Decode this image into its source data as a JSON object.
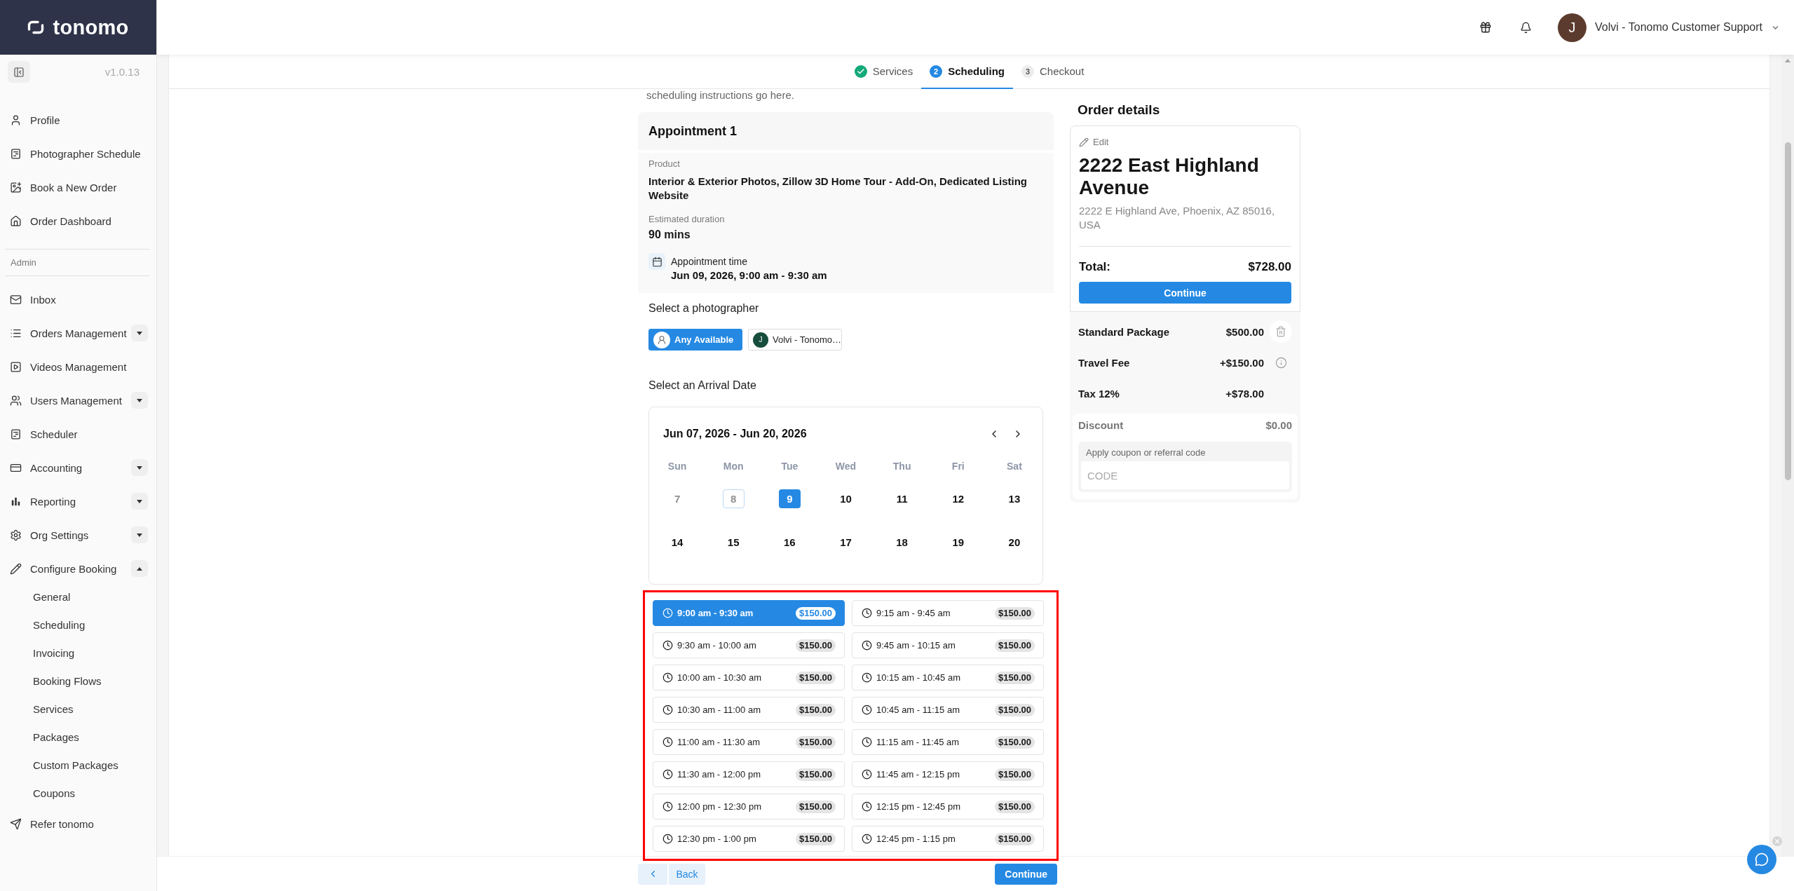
{
  "sidebar": {
    "logo": "tonomo",
    "version": "v1.0.13",
    "items": [
      {
        "label": "Profile"
      },
      {
        "label": "Photographer Schedule"
      },
      {
        "label": "Book a New Order"
      },
      {
        "label": "Order Dashboard"
      }
    ],
    "admin": {
      "heading": "Admin",
      "items": [
        {
          "kind": "link",
          "label": "Inbox"
        },
        {
          "kind": "group",
          "label": "Orders Management",
          "expanded": false
        },
        {
          "kind": "link",
          "label": "Videos Management"
        },
        {
          "kind": "group",
          "label": "Users Management",
          "expanded": false
        },
        {
          "kind": "link",
          "label": "Scheduler"
        },
        {
          "kind": "group",
          "label": "Accounting",
          "expanded": false
        },
        {
          "kind": "group",
          "label": "Reporting",
          "expanded": false
        },
        {
          "kind": "group",
          "label": "Org Settings",
          "expanded": false
        },
        {
          "kind": "group",
          "label": "Configure Booking",
          "expanded": true,
          "children": [
            {
              "label": "General"
            },
            {
              "label": "Scheduling"
            },
            {
              "label": "Invoicing"
            },
            {
              "label": "Booking Flows"
            },
            {
              "label": "Services"
            },
            {
              "label": "Packages"
            },
            {
              "label": "Custom Packages"
            },
            {
              "label": "Coupons"
            }
          ]
        },
        {
          "kind": "link",
          "label": "Refer tonomo"
        }
      ]
    }
  },
  "header": {
    "user_name": "Volvi - Tonomo Customer Support",
    "avatar_initial": "J"
  },
  "stepper": {
    "steps": [
      {
        "label": "Services",
        "done": true,
        "selected": false
      },
      {
        "number": "2",
        "label": "Scheduling",
        "done": false,
        "selected": true
      },
      {
        "number": "3",
        "label": "Checkout",
        "done": false,
        "selected": false
      }
    ]
  },
  "scheduling": {
    "instructions": "scheduling instructions go here.",
    "appointment": {
      "title": "Appointment 1",
      "product_label": "Product",
      "product": "Interior & Exterior Photos, Zillow 3D Home Tour - Add-On, Dedicated Listing Website",
      "duration_label": "Estimated duration",
      "duration": "90 mins",
      "time_label": "Appointment time",
      "time": "Jun 09, 2026, 9:00 am - 9:30 am"
    },
    "photographer": {
      "heading": "Select a photographer",
      "options": [
        {
          "kind": "any",
          "label": "Any Available",
          "selected": true
        },
        {
          "kind": "person",
          "initial": "J",
          "label": "Volvi - Tonomo…",
          "selected": false
        }
      ]
    },
    "calendar": {
      "heading": "Select an Arrival Date",
      "range": "Jun 07, 2026 - Jun 20, 2026",
      "weekdays": [
        "Sun",
        "Mon",
        "Tue",
        "Wed",
        "Thu",
        "Fri",
        "Sat"
      ],
      "weeks": [
        [
          {
            "day": "7",
            "disabled": true,
            "today": false,
            "selected": false
          },
          {
            "day": "8",
            "disabled": true,
            "today": true,
            "selected": false
          },
          {
            "day": "9",
            "disabled": false,
            "today": false,
            "selected": true
          },
          {
            "day": "10",
            "disabled": false,
            "today": false,
            "selected": false
          },
          {
            "day": "11",
            "disabled": false,
            "today": false,
            "selected": false
          },
          {
            "day": "12",
            "disabled": false,
            "today": false,
            "selected": false
          },
          {
            "day": "13",
            "disabled": false,
            "today": false,
            "selected": false
          }
        ],
        [
          {
            "day": "14",
            "disabled": false,
            "today": false,
            "selected": false
          },
          {
            "day": "15",
            "disabled": false,
            "today": false,
            "selected": false
          },
          {
            "day": "16",
            "disabled": false,
            "today": false,
            "selected": false
          },
          {
            "day": "17",
            "disabled": false,
            "today": false,
            "selected": false
          },
          {
            "day": "18",
            "disabled": false,
            "today": false,
            "selected": false
          },
          {
            "day": "19",
            "disabled": false,
            "today": false,
            "selected": false
          },
          {
            "day": "20",
            "disabled": false,
            "today": false,
            "selected": false
          }
        ]
      ]
    },
    "time_slots": [
      {
        "time": "9:00 am - 9:30 am",
        "price": "$150.00",
        "selected": true
      },
      {
        "time": "9:15 am - 9:45 am",
        "price": "$150.00",
        "selected": false
      },
      {
        "time": "9:30 am - 10:00 am",
        "price": "$150.00",
        "selected": false
      },
      {
        "time": "9:45 am - 10:15 am",
        "price": "$150.00",
        "selected": false
      },
      {
        "time": "10:00 am - 10:30 am",
        "price": "$150.00",
        "selected": false
      },
      {
        "time": "10:15 am - 10:45 am",
        "price": "$150.00",
        "selected": false
      },
      {
        "time": "10:30 am - 11:00 am",
        "price": "$150.00",
        "selected": false
      },
      {
        "time": "10:45 am - 11:15 am",
        "price": "$150.00",
        "selected": false
      },
      {
        "time": "11:00 am - 11:30 am",
        "price": "$150.00",
        "selected": false
      },
      {
        "time": "11:15 am - 11:45 am",
        "price": "$150.00",
        "selected": false
      },
      {
        "time": "11:30 am - 12:00 pm",
        "price": "$150.00",
        "selected": false
      },
      {
        "time": "11:45 am - 12:15 pm",
        "price": "$150.00",
        "selected": false
      },
      {
        "time": "12:00 pm - 12:30 pm",
        "price": "$150.00",
        "selected": false
      },
      {
        "time": "12:15 pm - 12:45 pm",
        "price": "$150.00",
        "selected": false
      },
      {
        "time": "12:30 pm - 1:00 pm",
        "price": "$150.00",
        "selected": false
      },
      {
        "time": "12:45 pm - 1:15 pm",
        "price": "$150.00",
        "selected": false
      }
    ]
  },
  "order_details": {
    "heading": "Order details",
    "edit": "Edit",
    "title": "2222 East Highland Avenue",
    "address": "2222 E Highland Ave, Phoenix, AZ 85016, USA",
    "total_label": "Total:",
    "total": "$728.00",
    "continue": "Continue",
    "lines": [
      {
        "kind": "removable",
        "label": "Standard Package",
        "amount": "$500.00"
      },
      {
        "kind": "info",
        "label": "Travel Fee",
        "amount": "+$150.00"
      },
      {
        "kind": "plain",
        "label": "Tax 12%",
        "amount": "+$78.00"
      }
    ],
    "discount": {
      "label": "Discount",
      "amount": "$0.00",
      "coupon_label": "Apply coupon or referral code",
      "placeholder": "CODE"
    }
  },
  "footer": {
    "back": "Back",
    "continue": "Continue"
  }
}
